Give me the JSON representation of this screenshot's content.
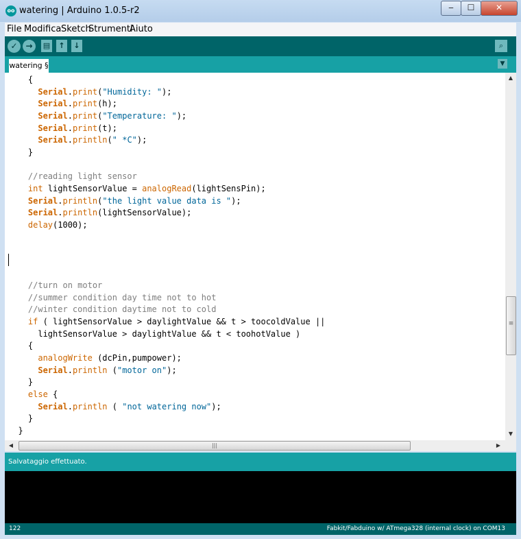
{
  "window": {
    "title": "watering | Arduino 1.0.5-r2",
    "logo_text": "oo",
    "minimize": "‒",
    "maximize": "☐",
    "close": "✕"
  },
  "menu": [
    "File",
    "Modifica",
    "Sketch",
    "Strumenti",
    "Aiuto"
  ],
  "toolbar": {
    "verify_icon": "✓",
    "upload_icon": "→",
    "new_icon": "▤",
    "open_icon": "↑",
    "save_icon": "↓",
    "serial_monitor_icon": "⌕"
  },
  "tabs": [
    {
      "label": "watering §"
    }
  ],
  "tab_menu_icon": "▼",
  "scroll_arrows": {
    "up": "▲",
    "down": "▼",
    "left": "◀",
    "right": "▶",
    "grip": "≡",
    "hgrip": "|||"
  },
  "code_lines": [
    {
      "indent": "    ",
      "tokens": [
        {
          "t": "{",
          "c": ""
        }
      ]
    },
    {
      "indent": "      ",
      "tokens": [
        {
          "t": "Serial",
          "c": "kw-bold"
        },
        {
          "t": ".",
          "c": ""
        },
        {
          "t": "print",
          "c": "kw-orange"
        },
        {
          "t": "(",
          "c": ""
        },
        {
          "t": "\"Humidity: \"",
          "c": "str"
        },
        {
          "t": ");",
          "c": ""
        }
      ]
    },
    {
      "indent": "      ",
      "tokens": [
        {
          "t": "Serial",
          "c": "kw-bold"
        },
        {
          "t": ".",
          "c": ""
        },
        {
          "t": "print",
          "c": "kw-orange"
        },
        {
          "t": "(h);",
          "c": ""
        }
      ]
    },
    {
      "indent": "      ",
      "tokens": [
        {
          "t": "Serial",
          "c": "kw-bold"
        },
        {
          "t": ".",
          "c": ""
        },
        {
          "t": "print",
          "c": "kw-orange"
        },
        {
          "t": "(",
          "c": ""
        },
        {
          "t": "\"Temperature: \"",
          "c": "str"
        },
        {
          "t": ");",
          "c": ""
        }
      ]
    },
    {
      "indent": "      ",
      "tokens": [
        {
          "t": "Serial",
          "c": "kw-bold"
        },
        {
          "t": ".",
          "c": ""
        },
        {
          "t": "print",
          "c": "kw-orange"
        },
        {
          "t": "(t);",
          "c": ""
        }
      ]
    },
    {
      "indent": "      ",
      "tokens": [
        {
          "t": "Serial",
          "c": "kw-bold"
        },
        {
          "t": ".",
          "c": ""
        },
        {
          "t": "println",
          "c": "kw-orange"
        },
        {
          "t": "(",
          "c": ""
        },
        {
          "t": "\" *C\"",
          "c": "str"
        },
        {
          "t": ");",
          "c": ""
        }
      ]
    },
    {
      "indent": "    ",
      "tokens": [
        {
          "t": "}",
          "c": ""
        }
      ]
    },
    {
      "indent": "",
      "tokens": []
    },
    {
      "indent": "    ",
      "tokens": [
        {
          "t": "//reading light sensor",
          "c": "cmt"
        }
      ]
    },
    {
      "indent": "    ",
      "tokens": [
        {
          "t": "int",
          "c": "kw-orange"
        },
        {
          "t": " lightSensorValue = ",
          "c": ""
        },
        {
          "t": "analogRead",
          "c": "kw-orange"
        },
        {
          "t": "(lightSensPin);",
          "c": ""
        }
      ]
    },
    {
      "indent": "    ",
      "tokens": [
        {
          "t": "Serial",
          "c": "kw-bold"
        },
        {
          "t": ".",
          "c": ""
        },
        {
          "t": "println",
          "c": "kw-orange"
        },
        {
          "t": "(",
          "c": ""
        },
        {
          "t": "\"the light value data is \"",
          "c": "str"
        },
        {
          "t": ");",
          "c": ""
        }
      ]
    },
    {
      "indent": "    ",
      "tokens": [
        {
          "t": "Serial",
          "c": "kw-bold"
        },
        {
          "t": ".",
          "c": ""
        },
        {
          "t": "println",
          "c": "kw-orange"
        },
        {
          "t": "(lightSensorValue);",
          "c": ""
        }
      ]
    },
    {
      "indent": "    ",
      "tokens": [
        {
          "t": "delay",
          "c": "kw-orange"
        },
        {
          "t": "(1000);",
          "c": ""
        }
      ]
    },
    {
      "indent": "",
      "tokens": []
    },
    {
      "indent": "",
      "tokens": []
    },
    {
      "indent": "",
      "tokens": []
    },
    {
      "indent": "",
      "tokens": []
    },
    {
      "indent": "    ",
      "tokens": [
        {
          "t": "//turn on motor",
          "c": "cmt"
        }
      ]
    },
    {
      "indent": "    ",
      "tokens": [
        {
          "t": "//summer condition day time not to hot",
          "c": "cmt"
        }
      ]
    },
    {
      "indent": "    ",
      "tokens": [
        {
          "t": "//winter condition daytime not to cold",
          "c": "cmt"
        }
      ]
    },
    {
      "indent": "    ",
      "tokens": [
        {
          "t": "if",
          "c": "kw-orange"
        },
        {
          "t": " ( lightSensorValue > daylightValue && t > toocoldValue ||",
          "c": ""
        }
      ]
    },
    {
      "indent": "      ",
      "tokens": [
        {
          "t": "lightSensorValue > daylightValue && t < toohotValue )",
          "c": ""
        }
      ]
    },
    {
      "indent": "    ",
      "tokens": [
        {
          "t": "{",
          "c": ""
        }
      ]
    },
    {
      "indent": "      ",
      "tokens": [
        {
          "t": "analogWrite",
          "c": "kw-orange"
        },
        {
          "t": " (dcPin,pumpower);",
          "c": ""
        }
      ]
    },
    {
      "indent": "      ",
      "tokens": [
        {
          "t": "Serial",
          "c": "kw-bold"
        },
        {
          "t": ".",
          "c": ""
        },
        {
          "t": "println",
          "c": "kw-orange"
        },
        {
          "t": " (",
          "c": ""
        },
        {
          "t": "\"motor on\"",
          "c": "str"
        },
        {
          "t": ");",
          "c": ""
        }
      ]
    },
    {
      "indent": "    ",
      "tokens": [
        {
          "t": "}",
          "c": ""
        }
      ]
    },
    {
      "indent": "    ",
      "tokens": [
        {
          "t": "else",
          "c": "kw-orange"
        },
        {
          "t": " {",
          "c": ""
        }
      ]
    },
    {
      "indent": "      ",
      "tokens": [
        {
          "t": "Serial",
          "c": "kw-bold"
        },
        {
          "t": ".",
          "c": ""
        },
        {
          "t": "println",
          "c": "kw-orange"
        },
        {
          "t": " ( ",
          "c": ""
        },
        {
          "t": "\"not watering now\"",
          "c": "str"
        },
        {
          "t": ");",
          "c": ""
        }
      ]
    },
    {
      "indent": "    ",
      "tokens": [
        {
          "t": "}",
          "c": ""
        }
      ]
    },
    {
      "indent": "  ",
      "tokens": [
        {
          "t": "}",
          "c": ""
        }
      ]
    }
  ],
  "status_message": "Salvataggio effettuato.",
  "footer": {
    "line_number": "122",
    "board_info": "Fabkit/Fabduino w/ ATmega328 (internal clock) on COM13"
  },
  "colors": {
    "toolbar_bg": "#006468",
    "tab_bar_bg": "#17a1a5",
    "keyword": "#cc6600",
    "string": "#006699",
    "comment": "#7e7e7e"
  }
}
